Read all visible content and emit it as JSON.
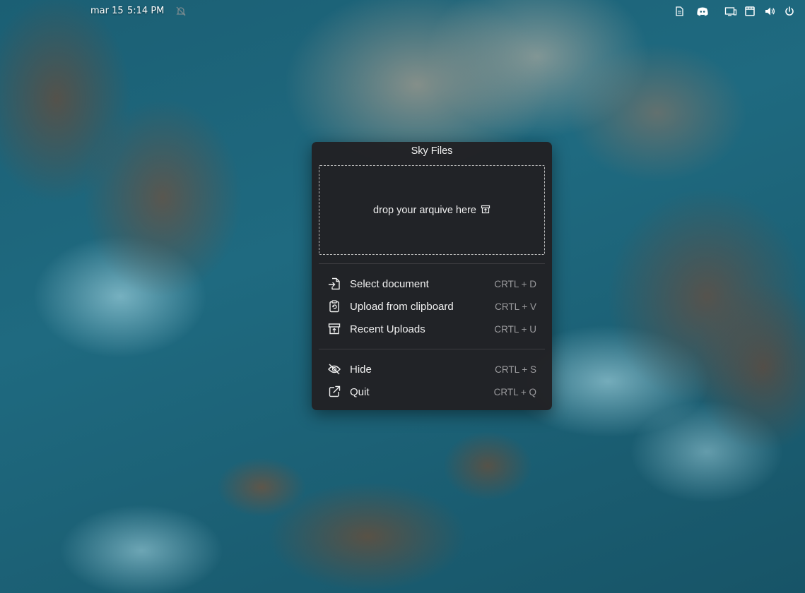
{
  "topbar": {
    "date": "mar 15",
    "time": "5:14 PM",
    "icons": [
      "notification-bell-off-icon",
      "document-icon",
      "discord-icon",
      "display-icon",
      "clipboard-icon",
      "volume-icon",
      "power-icon"
    ]
  },
  "panel": {
    "title": "Sky Files",
    "dropzone_label": "drop your arquive here",
    "menu_primary": [
      {
        "icon": "file-import-icon",
        "label": "Select document",
        "shortcut": "CRTL + D"
      },
      {
        "icon": "clipboard-upload-icon",
        "label": "Upload from clipboard",
        "shortcut": "CRTL + V"
      },
      {
        "icon": "archive-upload-icon",
        "label": "Recent Uploads",
        "shortcut": "CRTL + U"
      }
    ],
    "menu_secondary": [
      {
        "icon": "eye-off-icon",
        "label": "Hide",
        "shortcut": "CRTL + S"
      },
      {
        "icon": "external-link-icon",
        "label": "Quit",
        "shortcut": "CRTL + Q"
      }
    ]
  },
  "colors": {
    "panel_bg": "#212023",
    "text_primary": "#f0f0f0",
    "text_shortcut": "#9b9b9e",
    "dropzone_border": "#bdbdbd"
  }
}
